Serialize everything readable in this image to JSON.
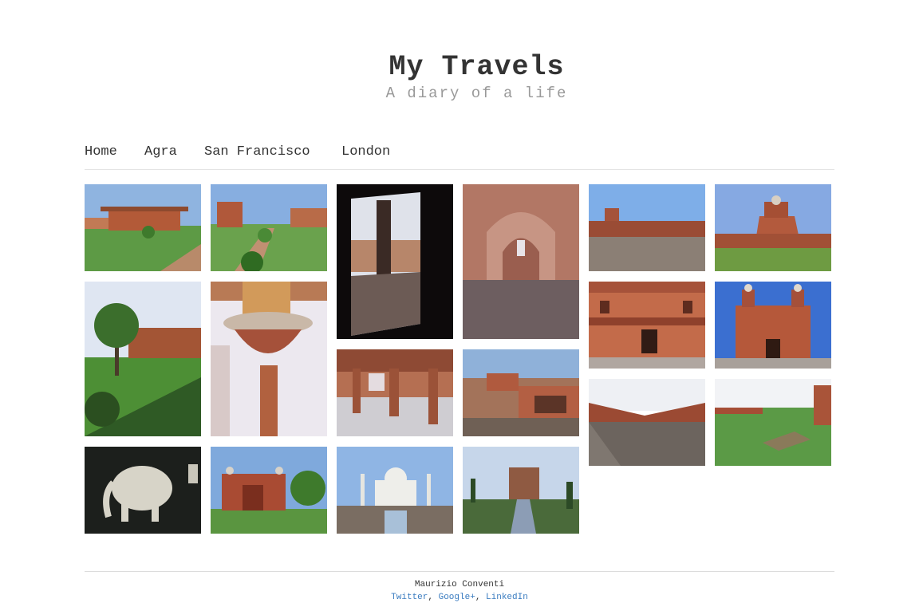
{
  "site": {
    "title": "My Travels",
    "subtitle": "A diary of a life"
  },
  "nav": {
    "items": [
      "Home",
      "Agra",
      "San Francisco",
      "London"
    ]
  },
  "footer": {
    "author": "Maurizio Conventi",
    "links": [
      "Twitter",
      "Google+",
      "LinkedIn"
    ],
    "link_color": "#3a7cc0"
  }
}
